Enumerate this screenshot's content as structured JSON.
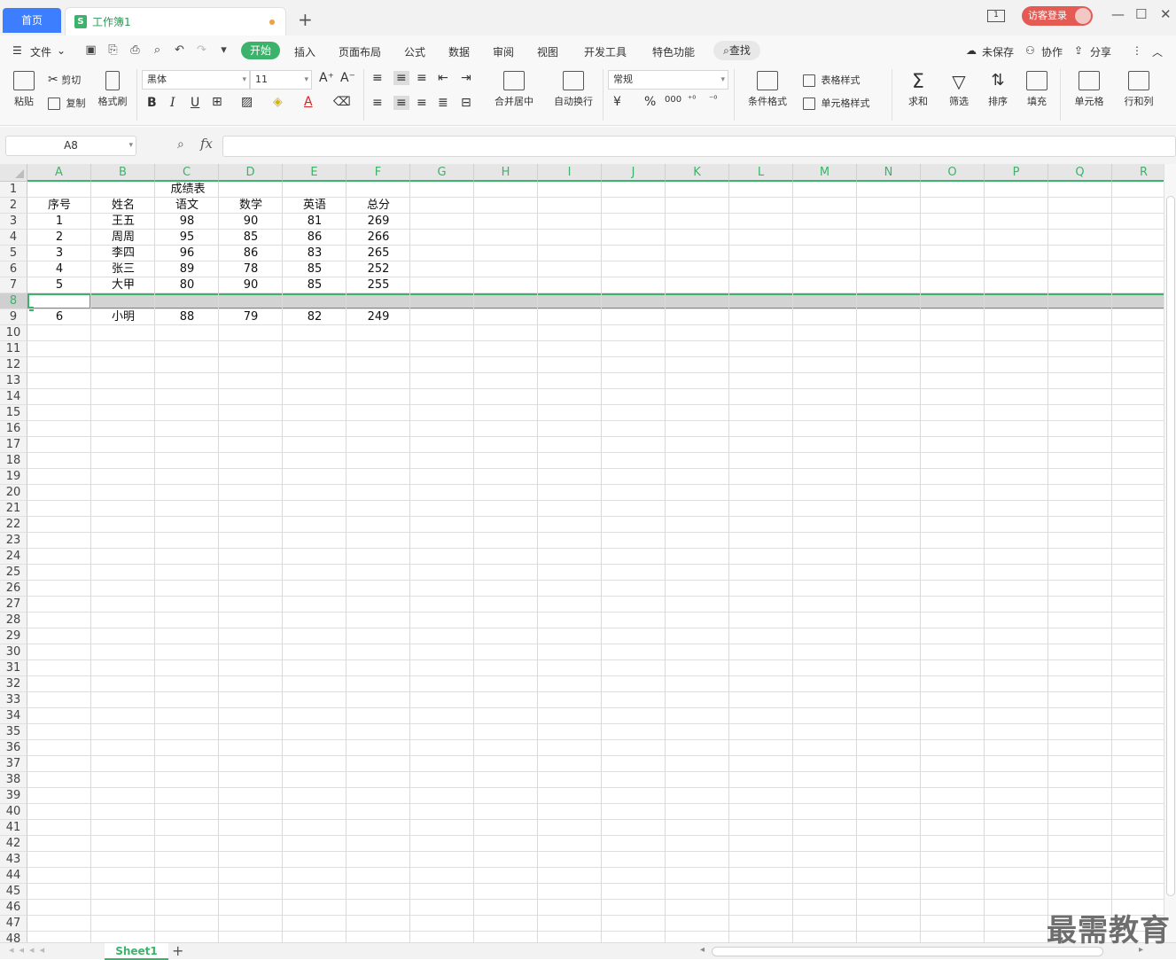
{
  "tabs": {
    "home": "首页",
    "workbook": "工作簿1",
    "workbook_icon": "S"
  },
  "titlebar": {
    "login": "访客登录",
    "monitor_label": "1"
  },
  "menu": {
    "file": "文件",
    "start": "开始",
    "items": [
      "插入",
      "页面布局",
      "公式",
      "数据",
      "审阅",
      "视图",
      "开发工具",
      "特色功能"
    ],
    "search": "查找",
    "unsaved": "未保存",
    "collab": "协作",
    "share": "分享"
  },
  "ribbon": {
    "paste": "粘贴",
    "cut": "剪切",
    "copy": "复制",
    "format_painter": "格式刷",
    "font_name": "黑体",
    "font_size": "11",
    "bold": "B",
    "italic": "I",
    "underline": "U",
    "merge_center": "合并居中",
    "wrap_text": "自动换行",
    "number_format": "常规",
    "currency": "¥",
    "percent": "%",
    "thousands": "000",
    "cond_format": "条件格式",
    "table_style": "表格样式",
    "cell_style": "单元格样式",
    "sum": "求和",
    "filter": "筛选",
    "sort": "排序",
    "fill": "填充",
    "cells": "单元格",
    "row_col": "行和列"
  },
  "formula_bar": {
    "name_box": "A8",
    "fx": "fx",
    "value": ""
  },
  "sheet": {
    "columns": [
      "A",
      "B",
      "C",
      "D",
      "E",
      "F",
      "G",
      "H",
      "I",
      "J",
      "K",
      "L",
      "M",
      "N",
      "O",
      "P",
      "Q",
      "R"
    ],
    "title": "成绩表",
    "headers": [
      "序号",
      "姓名",
      "语文",
      "数学",
      "英语",
      "总分"
    ],
    "rows": [
      {
        "row": 3,
        "cells": [
          "1",
          "王五",
          "98",
          "90",
          "81",
          "269"
        ]
      },
      {
        "row": 4,
        "cells": [
          "2",
          "周周",
          "95",
          "85",
          "86",
          "266"
        ]
      },
      {
        "row": 5,
        "cells": [
          "3",
          "李四",
          "96",
          "86",
          "83",
          "265"
        ]
      },
      {
        "row": 6,
        "cells": [
          "4",
          "张三",
          "89",
          "78",
          "85",
          "252"
        ]
      },
      {
        "row": 7,
        "cells": [
          "5",
          "大甲",
          "80",
          "90",
          "85",
          "255"
        ]
      },
      {
        "row": 9,
        "cells": [
          "6",
          "小明",
          "88",
          "79",
          "82",
          "249"
        ]
      }
    ],
    "row_count": 48,
    "selected_row": 8
  },
  "sheet_tabs": {
    "active": "Sheet1",
    "add": "+"
  },
  "watermark": "最需教育"
}
